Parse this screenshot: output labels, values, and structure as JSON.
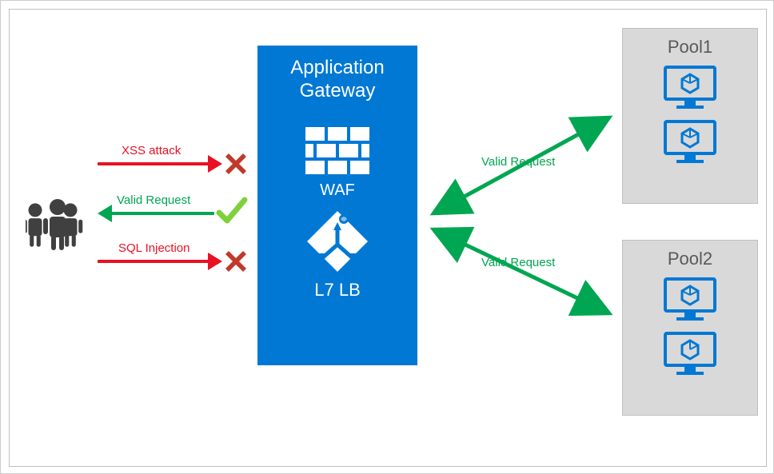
{
  "gateway": {
    "title_line1": "Application",
    "title_line2": "Gateway",
    "waf_label": "WAF",
    "lb_label": "L7 LB"
  },
  "flows": {
    "xss": "XSS attack",
    "valid_left": "Valid Request",
    "sql": "SQL Injection",
    "valid_top": "Valid Request",
    "valid_bottom": "Valid Request"
  },
  "pools": {
    "pool1_title": "Pool1",
    "pool2_title": "Pool2"
  },
  "colors": {
    "blue": "#0078d4",
    "red": "#e81123",
    "green": "#00a651",
    "grey_box": "#d9d9d9",
    "x_fill": "#c0392b"
  }
}
